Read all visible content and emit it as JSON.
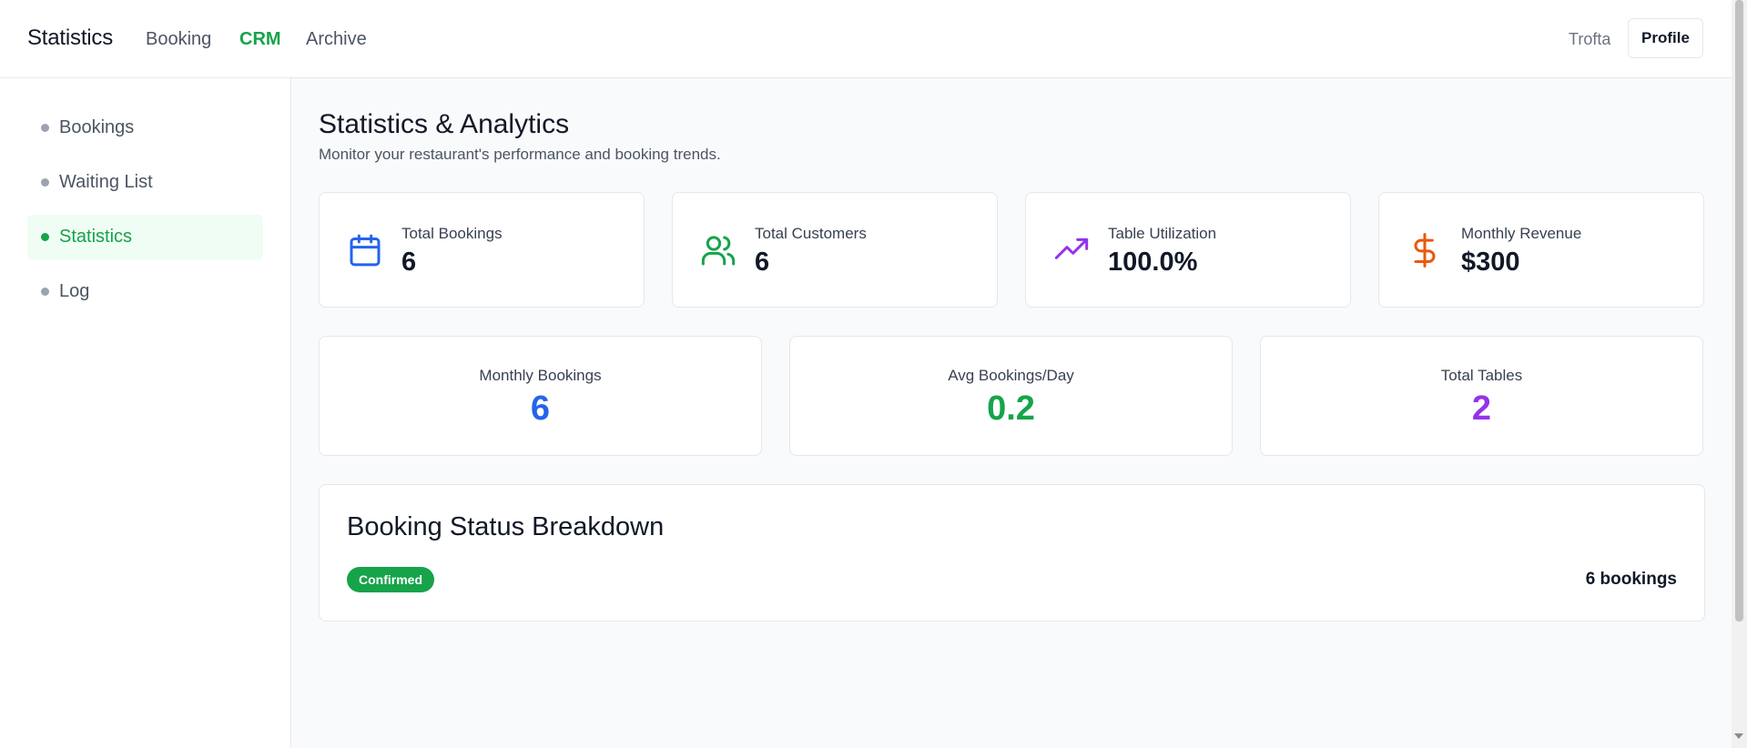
{
  "header": {
    "title": "Statistics",
    "nav": [
      {
        "label": "Booking",
        "active": false
      },
      {
        "label": "CRM",
        "active": true
      },
      {
        "label": "Archive",
        "active": false
      }
    ],
    "user_name": "Trofta",
    "profile_label": "Profile"
  },
  "sidebar": {
    "items": [
      {
        "label": "Bookings",
        "active": false
      },
      {
        "label": "Waiting List",
        "active": false
      },
      {
        "label": "Statistics",
        "active": true
      },
      {
        "label": "Log",
        "active": false
      }
    ]
  },
  "main": {
    "title": "Statistics & Analytics",
    "subtitle": "Monitor your restaurant's performance and booking trends.",
    "stats": [
      {
        "label": "Total Bookings",
        "value": "6",
        "icon": "calendar-icon",
        "icon_color": "#2563eb"
      },
      {
        "label": "Total Customers",
        "value": "6",
        "icon": "users-icon",
        "icon_color": "#16a34a"
      },
      {
        "label": "Table Utilization",
        "value": "100.0%",
        "icon": "trending-up-icon",
        "icon_color": "#9333ea"
      },
      {
        "label": "Monthly Revenue",
        "value": "$300",
        "icon": "dollar-icon",
        "icon_color": "#ea580c"
      }
    ],
    "metrics": [
      {
        "label": "Monthly Bookings",
        "value": "6",
        "color": "#2563eb"
      },
      {
        "label": "Avg Bookings/Day",
        "value": "0.2",
        "color": "#16a34a"
      },
      {
        "label": "Total Tables",
        "value": "2",
        "color": "#9333ea"
      }
    ],
    "breakdown": {
      "title": "Booking Status Breakdown",
      "rows": [
        {
          "status": "Confirmed",
          "count": "6 bookings",
          "color": "#16a34a"
        }
      ]
    }
  },
  "colors": {
    "accent": "#16a34a",
    "background": "#f9fafb"
  }
}
